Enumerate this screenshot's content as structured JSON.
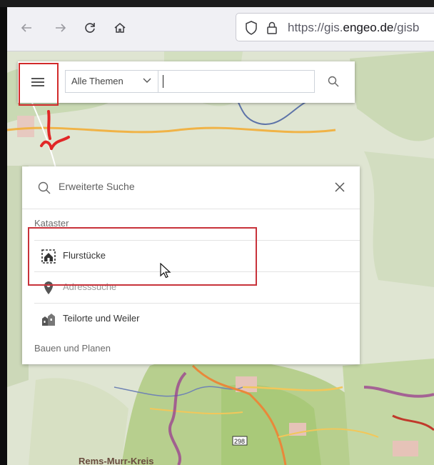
{
  "browser": {
    "url_prefix": "https://gis.",
    "url_domain": "engeo.de",
    "url_suffix": "/gisb"
  },
  "search": {
    "theme_selected": "Alle Themen",
    "input_value": ""
  },
  "dropdown": {
    "header_title": "Erweiterte Suche",
    "sections": [
      {
        "title": "Kataster",
        "items": [
          {
            "label": "Flurstücke",
            "icon": "parcel-house-icon"
          },
          {
            "label": "Adresssuche",
            "icon": "map-pin-icon"
          },
          {
            "label": "Teilorte und Weiler",
            "icon": "buildings-icon"
          }
        ]
      },
      {
        "title": "Bauen und Planen",
        "items": []
      }
    ]
  },
  "map": {
    "region_label": "Rems-Murr-Kreis",
    "route_badge": "298"
  },
  "colors": {
    "highlight_red": "#d12a2a",
    "map_background": "#dfe5d2",
    "boundary_purple": "#9a3b8f"
  }
}
